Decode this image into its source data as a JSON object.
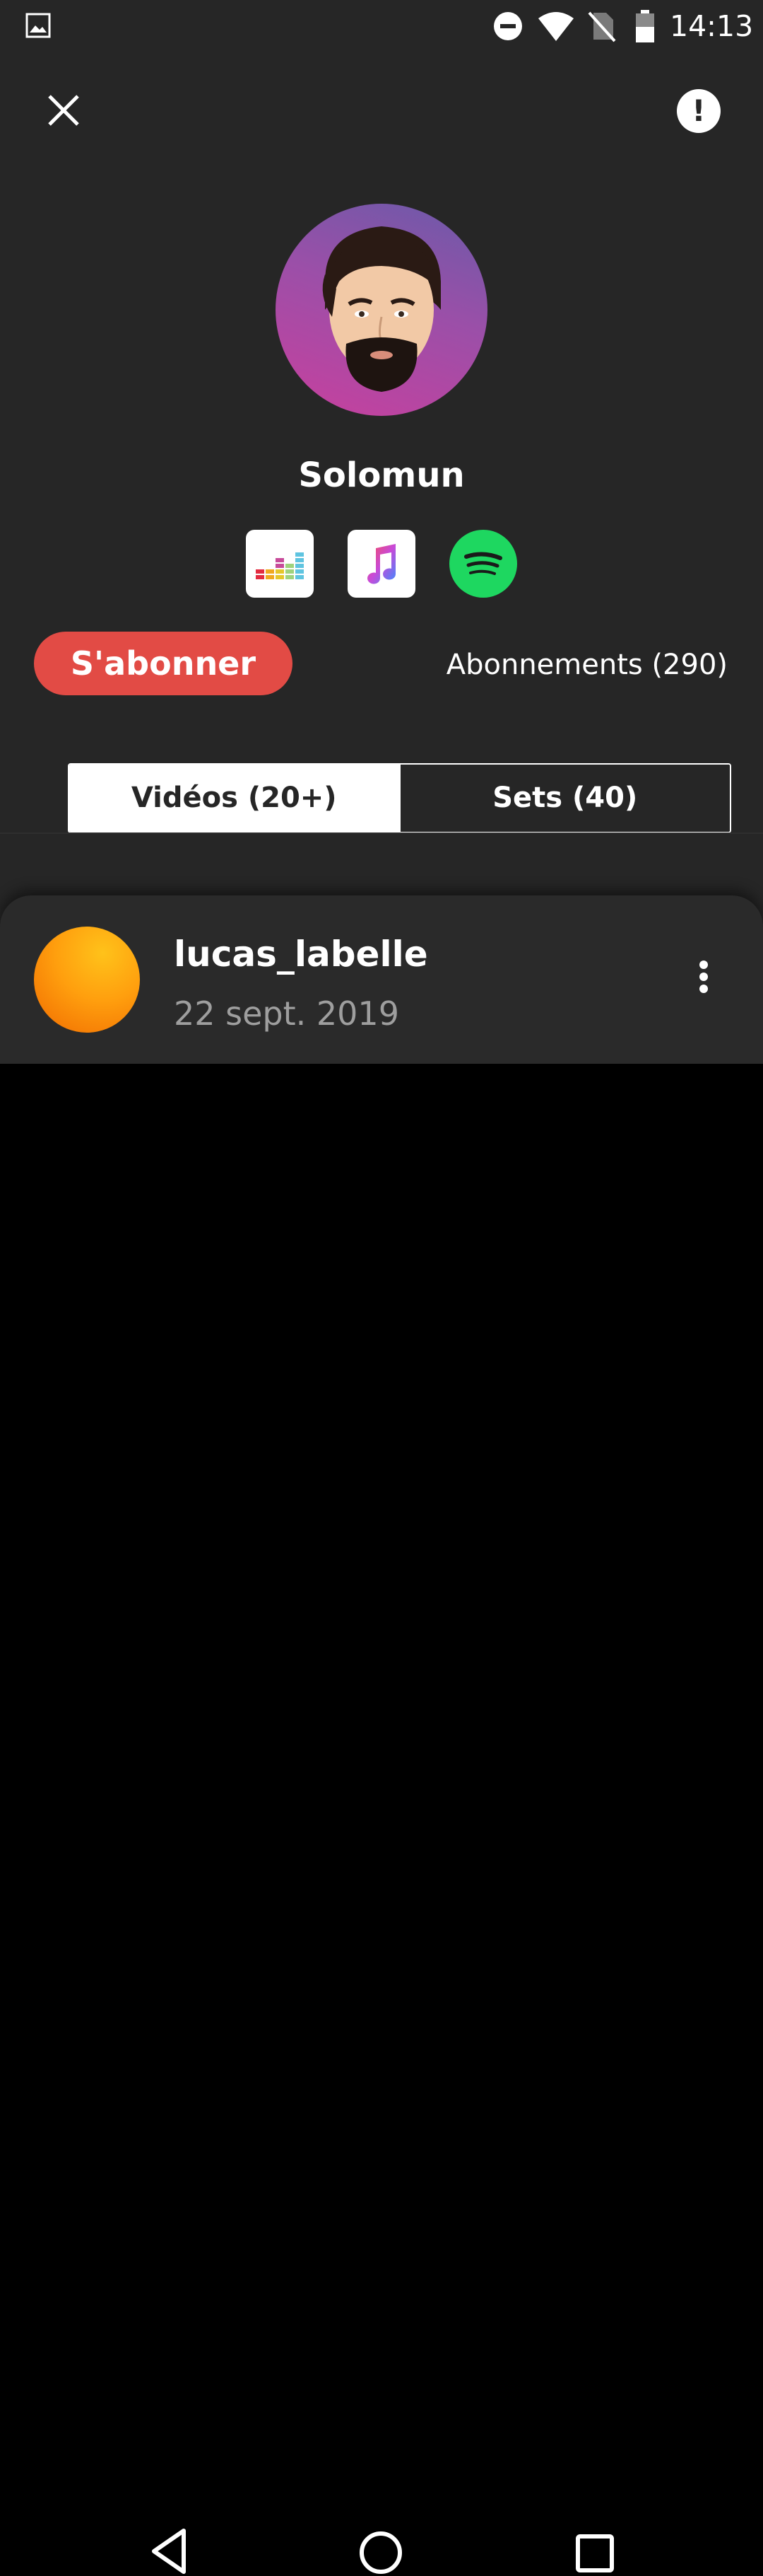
{
  "status_bar": {
    "time": "14:13",
    "icons": [
      "gallery-icon",
      "dnd-icon",
      "wifi-icon",
      "no-sim-icon",
      "battery-icon"
    ]
  },
  "header": {
    "close_icon": "close-icon",
    "report_label": "!"
  },
  "profile": {
    "name": "Solomun",
    "avatar_gradient": [
      "#6a5aa9",
      "#c8409e"
    ],
    "services": [
      {
        "name": "deezer-icon"
      },
      {
        "name": "apple-music-icon"
      },
      {
        "name": "spotify-icon"
      }
    ],
    "subscribe_label": "S'abonner",
    "subscriptions_label": "Abonnements (290)"
  },
  "tabs": [
    {
      "label": "Vidéos (20+)",
      "active": true
    },
    {
      "label": "Sets (40)",
      "active": false
    }
  ],
  "list": [
    {
      "user": "lucas_labelle",
      "date": "22 sept. 2019"
    }
  ],
  "colors": {
    "background": "#262626",
    "accent": "#e24b45",
    "spotify": "#1ed760"
  }
}
